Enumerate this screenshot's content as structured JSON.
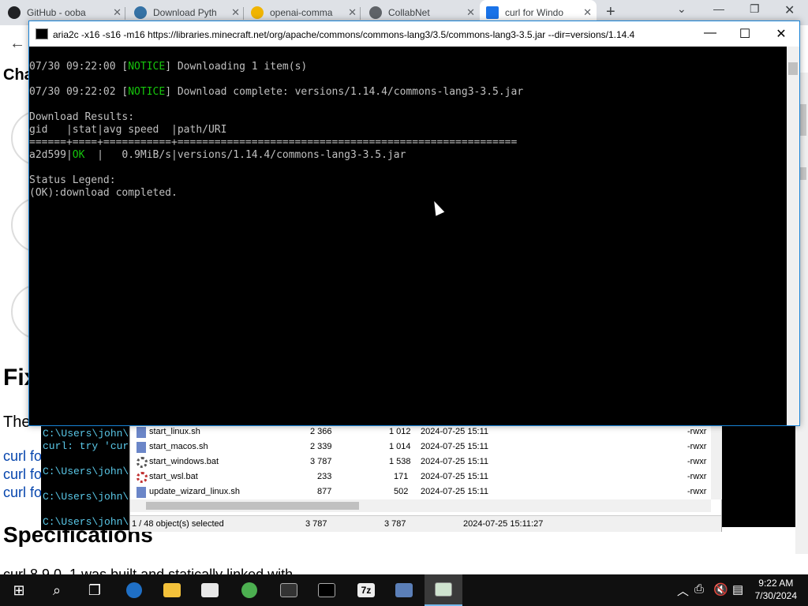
{
  "browser": {
    "tabs": [
      {
        "label": "GitHub - ooba",
        "icon": "github-icon",
        "color": "#202124"
      },
      {
        "label": "Download Pyth",
        "icon": "python-icon",
        "color": "#3572a5"
      },
      {
        "label": "openai-comma",
        "icon": "openai-icon",
        "color": "#f0b400"
      },
      {
        "label": "CollabNet",
        "icon": "globe-icon",
        "color": "#5f6368"
      },
      {
        "label": "curl for Windo",
        "icon": "curl-icon",
        "color": "#1a73e8"
      }
    ],
    "new_tab": "+"
  },
  "webpage": {
    "heading_fix": "Fix",
    "partial_the": "The",
    "links": [
      "curl fo",
      "curl fo",
      "curl fo"
    ],
    "heading_specs": "Specifications",
    "partial_top": "Cha",
    "partial_bottom": "curl 8.9.0_1 was built and statically linked with"
  },
  "console": {
    "title": "aria2c  -x16 -s16 -m16 https://libraries.minecraft.net/org/apache/commons/commons-lang3/3.5/commons-lang3-3.5.jar --dir=versions/1.14.4",
    "lines": [
      {
        "pre": "07/30 09:22:00 [",
        "tag": "NOTICE",
        "post": "] Downloading 1 item(s)"
      },
      {
        "pre": "07/30 09:22:02 [",
        "tag": "NOTICE",
        "post": "] Download complete: versions/1.14.4/commons-lang3-3.5.jar"
      }
    ],
    "results_header": "Download Results:",
    "table_header": "gid   |stat|avg speed  |path/URI",
    "table_sep": "======+====+===========+=======================================================",
    "row": {
      "gid": "a2d599",
      "stat": "OK",
      "rest": "  |   0.9MiB/s|versions/1.14.4/commons-lang3-3.5.jar"
    },
    "legend_title": "Status Legend:",
    "legend_ok": "(OK):download completed."
  },
  "backterm": {
    "lines": [
      "C:\\Users\\john\\",
      "curl: try 'cur",
      "C:\\Users\\john\\",
      "C:\\Users\\john\\",
      "C:\\Users\\john\\"
    ]
  },
  "filemanager": {
    "rows": [
      {
        "name": "start_linux.sh",
        "size": "2 366",
        "packed": "1 012",
        "date": "2024-07-25 15:11",
        "attr": "-rwxr",
        "icon": "script-icon"
      },
      {
        "name": "start_macos.sh",
        "size": "2 339",
        "packed": "1 014",
        "date": "2024-07-25 15:11",
        "attr": "-rwxr",
        "icon": "script-icon"
      },
      {
        "name": "start_windows.bat",
        "size": "3 787",
        "packed": "1 538",
        "date": "2024-07-25 15:11",
        "attr": "-rwxr",
        "icon": "gear-icon"
      },
      {
        "name": "start_wsl.bat",
        "size": "233",
        "packed": "171",
        "date": "2024-07-25 15:11",
        "attr": "-rwxr",
        "icon": "gear-icon"
      },
      {
        "name": "update_wizard_linux.sh",
        "size": "877",
        "packed": "502",
        "date": "2024-07-25 15:11",
        "attr": "-rwxr",
        "icon": "script-icon"
      }
    ],
    "status": {
      "selected": "1 / 48 object(s) selected",
      "size": "3 787",
      "packed": "3 787",
      "date": "2024-07-25 15:11:27"
    }
  },
  "taskbar": {
    "time": "9:22 AM",
    "date": "7/30/2024"
  }
}
